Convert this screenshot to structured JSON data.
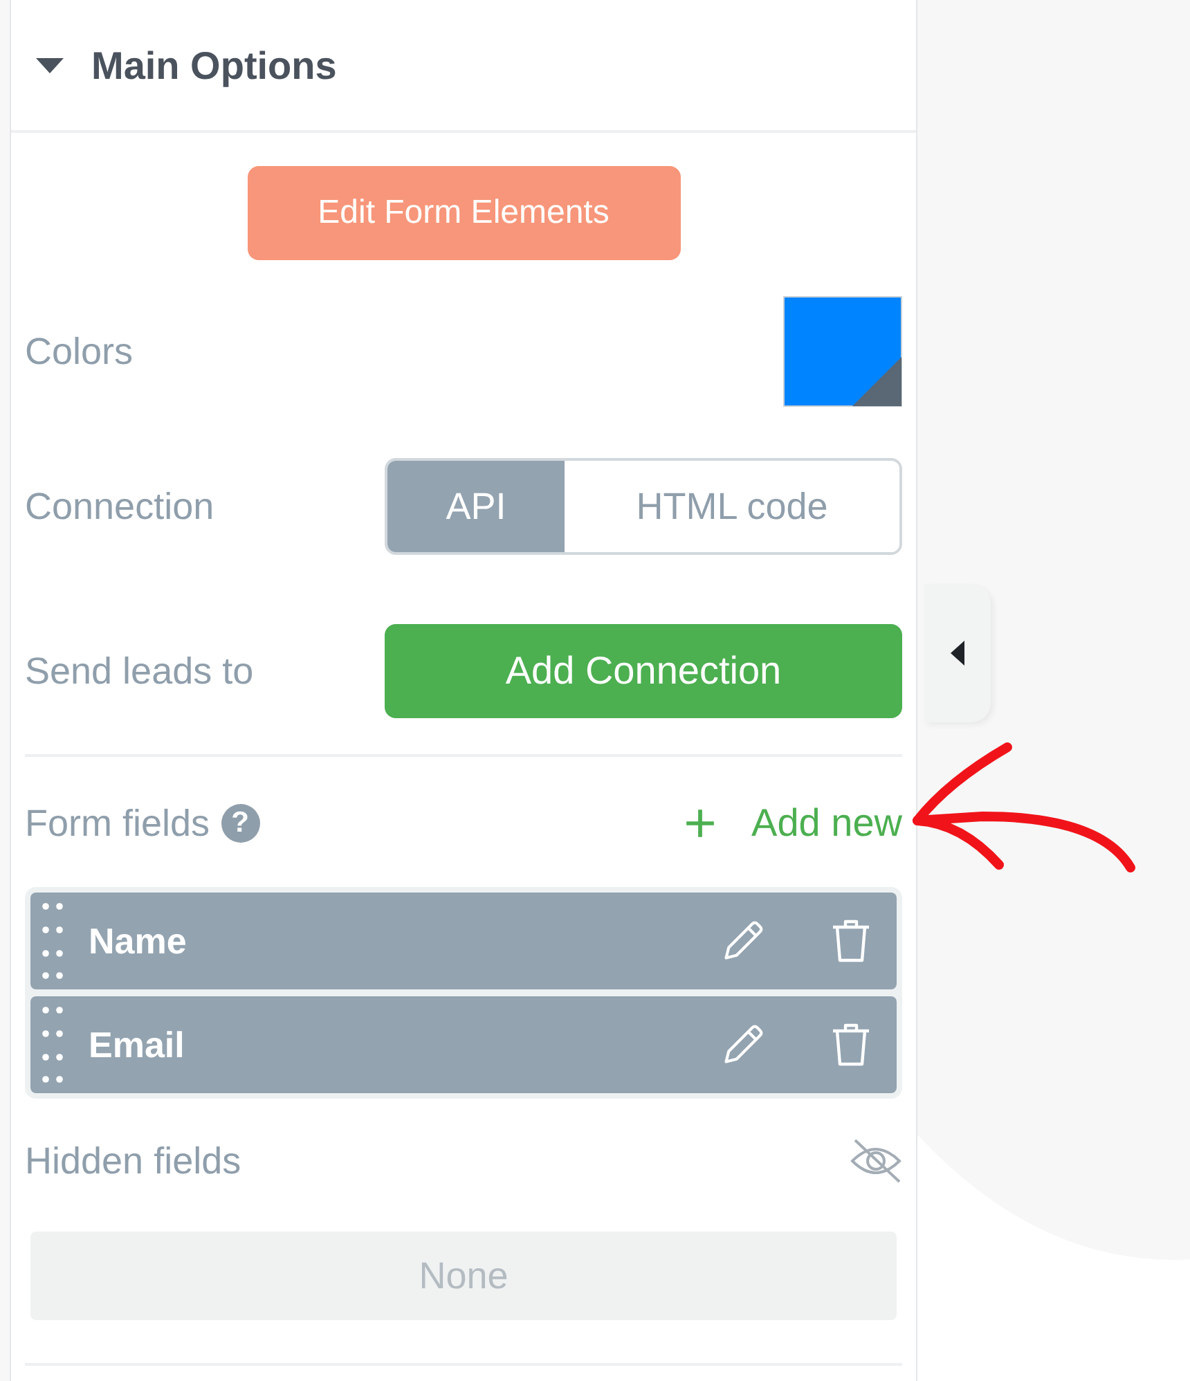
{
  "panel": {
    "title": "Main Options",
    "expanded": true
  },
  "edit_button": "Edit Form Elements",
  "colors": {
    "label": "Colors"
  },
  "connection": {
    "label": "Connection",
    "options": [
      {
        "label": "API",
        "selected": true
      },
      {
        "label": "HTML code",
        "selected": false
      }
    ]
  },
  "send_leads": {
    "label": "Send leads to",
    "button": "Add Connection"
  },
  "form_fields": {
    "label": "Form fields",
    "help": "?",
    "add": "Add new",
    "items": [
      {
        "name": "Name"
      },
      {
        "name": "Email"
      }
    ]
  },
  "hidden_fields": {
    "label": "Hidden fields",
    "placeholder": "None"
  }
}
